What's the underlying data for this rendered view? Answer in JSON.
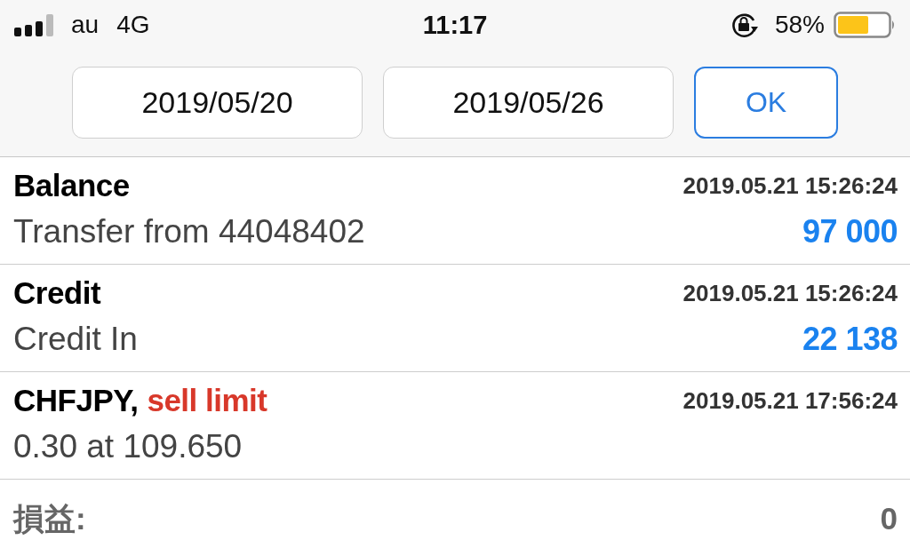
{
  "status_bar": {
    "carrier": "au",
    "network": "4G",
    "time": "11:17",
    "battery_percent": "58%"
  },
  "date_filter": {
    "start_date": "2019/05/20",
    "end_date": "2019/05/26",
    "confirm_button": "OK"
  },
  "entries": [
    {
      "title": "Balance",
      "time": "2019.05.21 15:26:24",
      "description": "Transfer from 44048402",
      "amount": "97 000"
    },
    {
      "title": "Credit",
      "time": "2019.05.21 15:26:24",
      "description": "Credit In",
      "amount": "22 138"
    },
    {
      "title": "CHFJPY,",
      "order_type": "sell limit",
      "time": "2019.05.21 17:56:24",
      "description": "0.30 at 109.650"
    }
  ],
  "summary": {
    "label": "損益:",
    "value": "0"
  }
}
